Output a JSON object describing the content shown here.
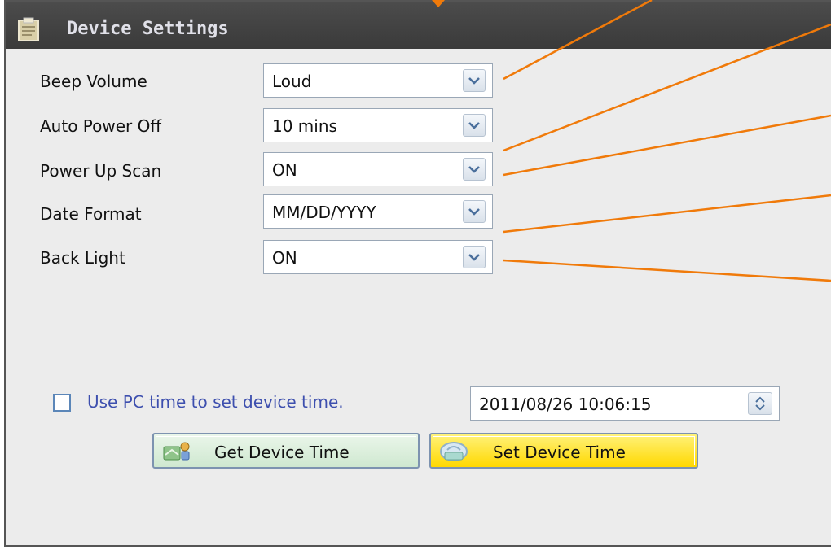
{
  "window": {
    "title": "Device Settings"
  },
  "settings": {
    "beep_volume": {
      "label": "Beep Volume",
      "value": "Loud"
    },
    "auto_power_off": {
      "label": "Auto Power Off",
      "value": "10 mins"
    },
    "power_up_scan": {
      "label": "Power Up Scan",
      "value": "ON"
    },
    "date_format": {
      "label": "Date Format",
      "value": "MM/DD/YYYY"
    },
    "back_light": {
      "label": "Back Light",
      "value": "ON"
    }
  },
  "time": {
    "use_pc_time_label": "Use PC time to set device time.",
    "use_pc_time_checked": false,
    "datetime_value": "2011/08/26 10:06:15"
  },
  "buttons": {
    "get_device_time": "Get Device Time",
    "set_device_time": "Set Device Time"
  },
  "colors": {
    "annotation_lines": "#f07a0a",
    "titlebar": "#444444",
    "set_button": "#ffe000",
    "get_button": "#d6eed7"
  }
}
